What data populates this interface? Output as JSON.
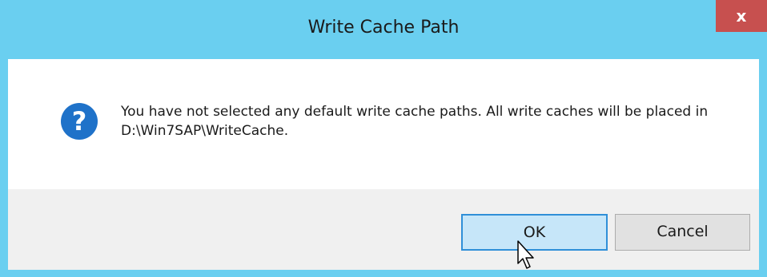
{
  "dialog": {
    "title": "Write Cache Path",
    "close_glyph": "x",
    "message": "You have not selected any default write cache paths. All write caches will be placed in D:\\Win7SAP\\WriteCache.",
    "icon": "question-icon",
    "buttons": {
      "ok_label": "OK",
      "cancel_label": "Cancel"
    }
  },
  "colors": {
    "titlebar": "#6acff0",
    "close_button": "#c7504f",
    "question_icon": "#1f72c9",
    "ok_button_border": "#2f8fd8"
  }
}
